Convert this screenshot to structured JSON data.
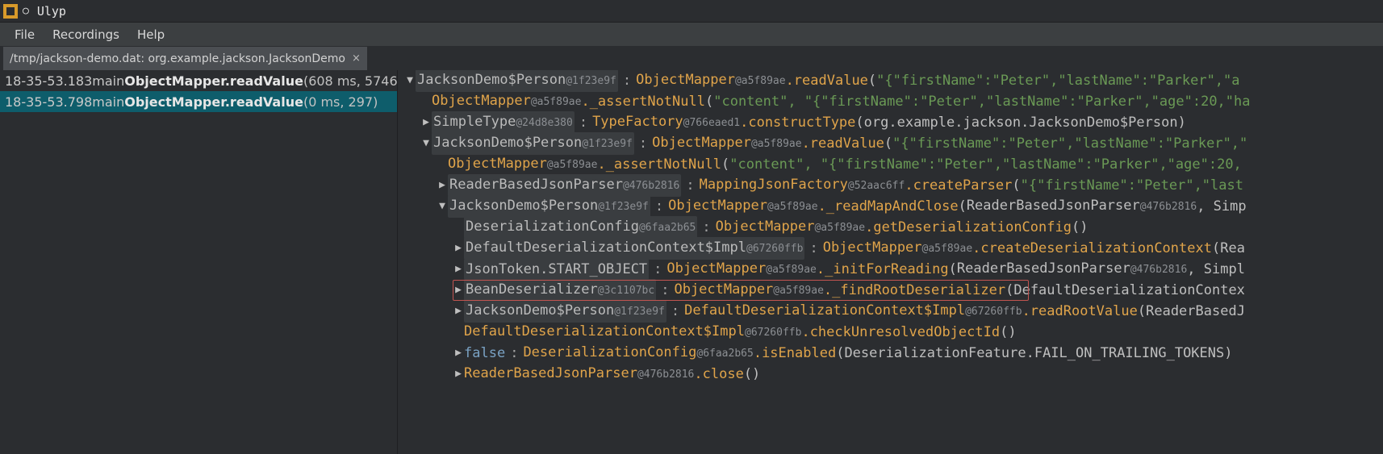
{
  "titlebar": {
    "title": "Ulyp",
    "win_btn": "○"
  },
  "menubar": {
    "file": "File",
    "recordings": "Recordings",
    "help": "Help"
  },
  "tabbar": {
    "tab0": {
      "label": "/tmp/jackson-demo.dat: org.example.jackson.JacksonDemo",
      "close": "×"
    }
  },
  "sidebar": {
    "rows": [
      {
        "ts": "18-35-53.183",
        "thread": "main",
        "method": "ObjectMapper.readValue",
        "info": "(608 ms, 5746)"
      },
      {
        "ts": "18-35-53.798",
        "thread": "main",
        "method": "ObjectMapper.readValue",
        "info": "(0 ms, 297)"
      }
    ]
  },
  "tree": {
    "rows": [
      {
        "indent": 0,
        "arrow": "▼",
        "ret": "JacksonDemo$Person",
        "retHash": "@1f23e9f",
        "cls": "ObjectMapper",
        "clsHash": "@a5f89ae",
        "method": ".readValue",
        "after": "(",
        "str": "\"{\"firstName\":\"Peter\",\"lastName\":\"Parker\",\"a",
        "tail": ""
      },
      {
        "indent": 1,
        "arrow": "",
        "ret": "",
        "retHash": "",
        "cls": "ObjectMapper",
        "clsHash": "@a5f89ae",
        "method": "._assertNotNull",
        "after": "(",
        "str": "\"content\", \"{\"firstName\":\"Peter\",\"lastName\":\"Parker\",\"age\":20,\"ha",
        "tail": ""
      },
      {
        "indent": 1,
        "arrow": "▶",
        "ret": "SimpleType",
        "retHash": "@24d8e380",
        "cls": "TypeFactory",
        "clsHash": "@766eaed1",
        "method": ".constructType",
        "after": "(",
        "argsPlain": "org.example.jackson.JacksonDemo$Person",
        "tail": ")"
      },
      {
        "indent": 1,
        "arrow": "▼",
        "ret": "JacksonDemo$Person",
        "retHash": "@1f23e9f",
        "cls": "ObjectMapper",
        "clsHash": "@a5f89ae",
        "method": ".readValue",
        "after": "(",
        "str": "\"{\"firstName\":\"Peter\",\"lastName\":\"Parker\",\"",
        "tail": ""
      },
      {
        "indent": 2,
        "arrow": "",
        "ret": "",
        "retHash": "",
        "cls": "ObjectMapper",
        "clsHash": "@a5f89ae",
        "method": "._assertNotNull",
        "after": "(",
        "str": "\"content\", \"{\"firstName\":\"Peter\",\"lastName\":\"Parker\",\"age\":20,",
        "tail": ""
      },
      {
        "indent": 2,
        "arrow": "▶",
        "ret": "ReaderBasedJsonParser",
        "retHash": "@476b2816",
        "cls": "MappingJsonFactory",
        "clsHash": "@52aac6ff",
        "method": ".createParser",
        "after": "(",
        "str": "\"{\"firstName\":\"Peter\",\"last",
        "tail": ""
      },
      {
        "indent": 2,
        "arrow": "▼",
        "ret": "JacksonDemo$Person",
        "retHash": "@1f23e9f",
        "cls": "ObjectMapper",
        "clsHash": "@a5f89ae",
        "method": "._readMapAndClose",
        "after": "(",
        "argsPlain": "ReaderBasedJsonParser",
        "argsHash": "@476b2816",
        "tailPlain": ", Simp"
      },
      {
        "indent": 3,
        "arrow": "",
        "ret": "DeserializationConfig",
        "retHash": "@6faa2b65",
        "cls": "ObjectMapper",
        "clsHash": "@a5f89ae",
        "method": ".getDeserializationConfig",
        "after": "()",
        "tail": ""
      },
      {
        "indent": 3,
        "arrow": "▶",
        "ret": "DefaultDeserializationContext$Impl",
        "retHash": "@67260ffb",
        "cls": "ObjectMapper",
        "clsHash": "@a5f89ae",
        "method": ".createDeserializationContext",
        "after": "(",
        "tailPlain": "Rea"
      },
      {
        "indent": 3,
        "arrow": "▶",
        "ret": "JsonToken.START_OBJECT",
        "retHash": "",
        "cls": "ObjectMapper",
        "clsHash": "@a5f89ae",
        "method": "._initForReading",
        "after": "(",
        "argsPlain": "ReaderBasedJsonParser",
        "argsHash": "@476b2816",
        "tailPlain": ", Simpl"
      },
      {
        "indent": 3,
        "arrow": "▶",
        "ret": "BeanDeserializer",
        "retHash": "@3c1107bc",
        "cls": "ObjectMapper",
        "clsHash": "@a5f89ae",
        "method": "._findRootDeserializer",
        "after": "(",
        "tailPlain": "DefaultDeserializationContex",
        "highlight": true,
        "hlLeft": 560,
        "hlWidth": 714
      },
      {
        "indent": 3,
        "arrow": "▶",
        "ret": "JacksonDemo$Person",
        "retHash": "@1f23e9f",
        "cls": "DefaultDeserializationContext$Impl",
        "clsHash": "@67260ffb",
        "method": ".readRootValue",
        "after": "(",
        "tailPlain": "ReaderBasedJ"
      },
      {
        "indent": 3,
        "arrow": "",
        "ret": "",
        "retHash": "",
        "cls": "DefaultDeserializationContext$Impl",
        "clsHash": "@67260ffb",
        "method": ".checkUnresolvedObjectId",
        "after": "()",
        "tail": ""
      },
      {
        "indent": 3,
        "arrow": "▶",
        "ret": "false",
        "retHash": "",
        "retIdent": true,
        "cls": "DeserializationConfig",
        "clsHash": "@6faa2b65",
        "method": ".isEnabled",
        "after": "(",
        "argsPlain": "DeserializationFeature.FAIL_ON_TRAILING_TOKENS",
        "tail": ")"
      },
      {
        "indent": 3,
        "arrow": "▶",
        "ret": "",
        "retHash": "",
        "cls": "ReaderBasedJsonParser",
        "clsCall": true,
        "clsHash": "@476b2816",
        "method": ".close",
        "after": "()",
        "tail": ""
      }
    ]
  }
}
